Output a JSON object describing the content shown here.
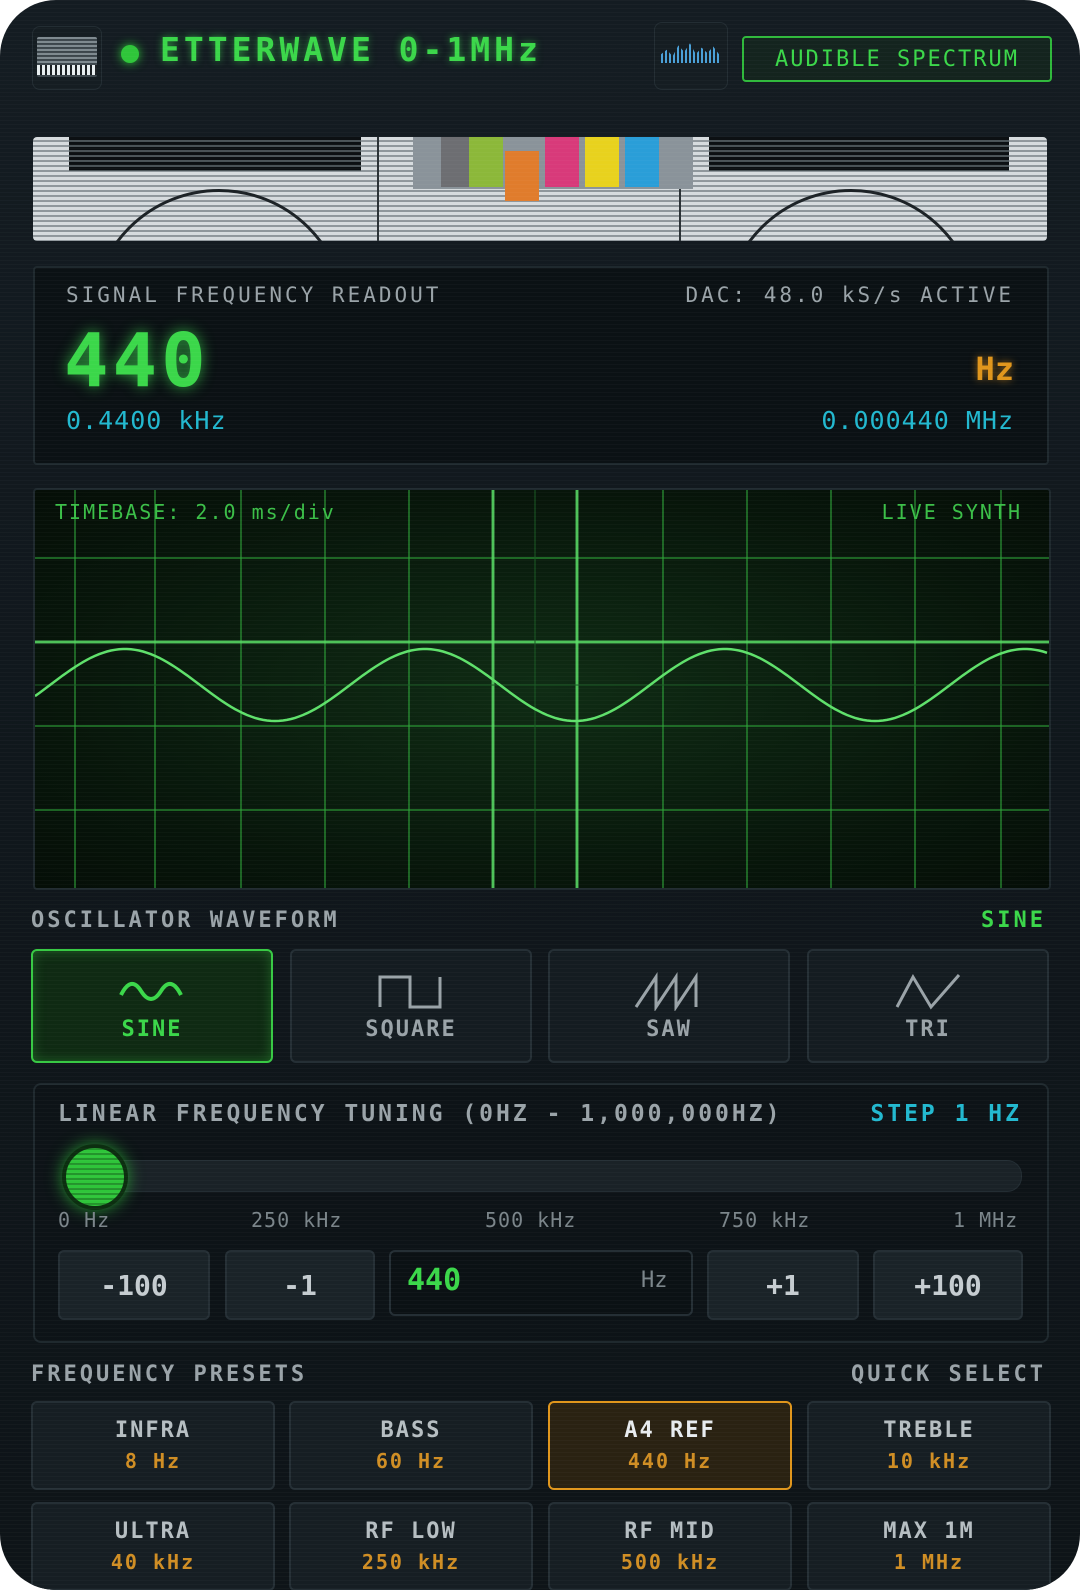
{
  "header": {
    "title": "ETTERWAVE 0-1MHz",
    "spectrum_label": "AUDIBLE SPECTRUM",
    "status_color": "#2fc53a"
  },
  "readout": {
    "label": "SIGNAL FREQUENCY READOUT",
    "dac": "DAC: 48.0 kS/s ACTIVE",
    "value": "440",
    "unit": "Hz",
    "khz": "0.4400 kHz",
    "mhz": "0.000440 MHz"
  },
  "scope": {
    "timebase": "TIMEBASE: 2.0 ms/div",
    "mode": "LIVE SYNTH"
  },
  "waveform": {
    "label": "OSCILLATOR WAVEFORM",
    "selected": "SINE",
    "options": [
      {
        "label": "SINE",
        "icon": "sine-wave-icon"
      },
      {
        "label": "SQUARE",
        "icon": "square-wave-icon"
      },
      {
        "label": "SAW",
        "icon": "saw-wave-icon"
      },
      {
        "label": "TRI",
        "icon": "triangle-wave-icon"
      }
    ]
  },
  "tuning": {
    "label": "LINEAR FREQUENCY TUNING (0HZ - 1,000,000HZ)",
    "step": "STEP 1 HZ",
    "slider_fraction": 0.00044,
    "ticks": [
      "0 Hz",
      "250 kHz",
      "500 kHz",
      "750 kHz",
      "1 MHz"
    ],
    "buttons": [
      "-100",
      "-1",
      "+1",
      "+100"
    ],
    "input_value": "440",
    "input_unit": "Hz"
  },
  "presets": {
    "label": "FREQUENCY PRESETS",
    "quick": "QUICK SELECT",
    "items": [
      {
        "name": "INFRA",
        "value": "8 Hz"
      },
      {
        "name": "BASS",
        "value": "60 Hz"
      },
      {
        "name": "A4 REF",
        "value": "440 Hz"
      },
      {
        "name": "TREBLE",
        "value": "10 kHz"
      },
      {
        "name": "ULTRA",
        "value": "40 kHz"
      },
      {
        "name": "RF LOW",
        "value": "250 kHz"
      },
      {
        "name": "RF MID",
        "value": "500 kHz"
      },
      {
        "name": "MAX 1M",
        "value": "1 MHz"
      }
    ],
    "active_color": "#e0961c"
  }
}
